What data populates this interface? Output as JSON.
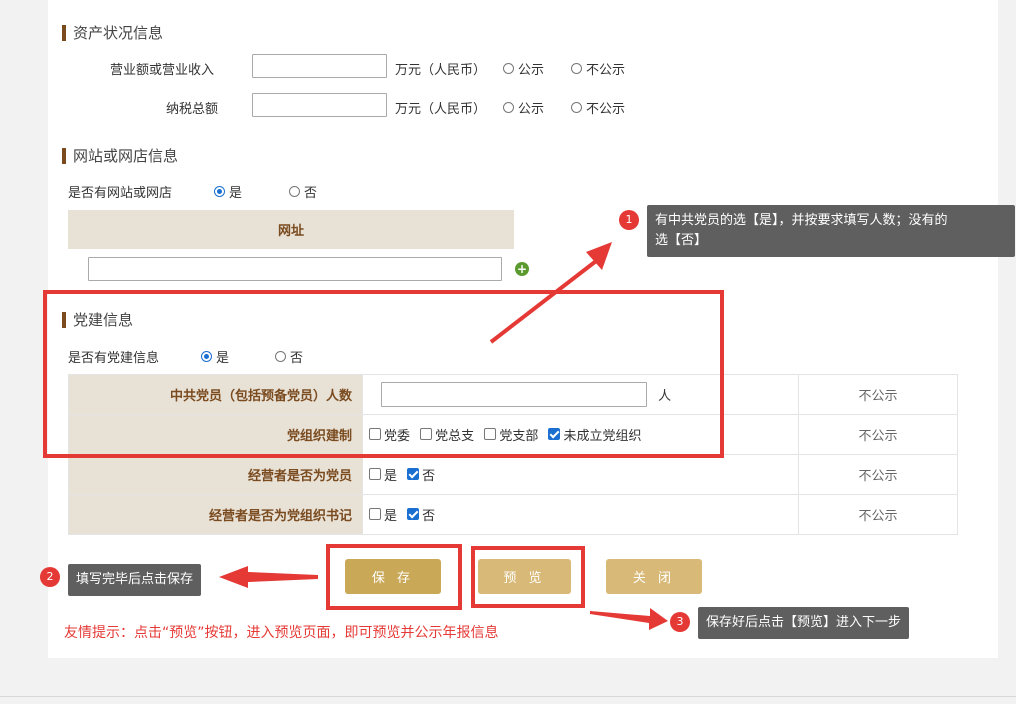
{
  "assets": {
    "title": "资产状况信息",
    "rows": [
      {
        "label": "营业额或营业收入",
        "unit": "万元（人民币）",
        "opt_public": "公示",
        "opt_private": "不公示"
      },
      {
        "label": "纳税总额",
        "unit": "万元（人民币）",
        "opt_public": "公示",
        "opt_private": "不公示"
      }
    ]
  },
  "website": {
    "title": "网站或网店信息",
    "question": "是否有网站或网店",
    "yes": "是",
    "no": "否",
    "selected": "yes",
    "table_header": "网址",
    "url_value": ""
  },
  "party": {
    "title": "党建信息",
    "question": "是否有党建信息",
    "yes": "是",
    "no": "否",
    "selected": "yes",
    "rows": {
      "members": {
        "label": "中共党员（包括预备党员）人数",
        "unit": "人",
        "value": "",
        "public": "不公示"
      },
      "org": {
        "label": "党组织建制",
        "options": [
          "党委",
          "党总支",
          "党支部",
          "未成立党组织"
        ],
        "checked": [
          false,
          false,
          false,
          true
        ],
        "public": "不公示"
      },
      "operator_member": {
        "label": "经营者是否为党员",
        "yes": "是",
        "no": "否",
        "checked_yes": false,
        "checked_no": true,
        "public": "不公示"
      },
      "operator_secretary": {
        "label": "经营者是否为党组织书记",
        "yes": "是",
        "no": "否",
        "checked_yes": false,
        "checked_no": true,
        "public": "不公示"
      }
    }
  },
  "buttons": {
    "save": "保 存",
    "preview": "预 览",
    "close": "关 闭"
  },
  "annotations": {
    "tip1": {
      "num": "1",
      "line1": "有中共党员的选【是】，并按要求填写人数；没有的",
      "line2": "选【否】"
    },
    "tip2": {
      "num": "2",
      "text": "填写完毕后点击保存"
    },
    "tip3": {
      "num": "3",
      "text": "保存好后点击【预览】进入下一步"
    }
  },
  "hint": "友情提示：点击“预览”按钮，进入预览页面，即可预览并公示年报信息",
  "colors": {
    "accent_brown": "#7a4b1f",
    "header_bg": "#e8e1d6",
    "button_gold": "#c9a857",
    "annotation_red": "#e53935",
    "radio_blue": "#1a6fd1"
  }
}
